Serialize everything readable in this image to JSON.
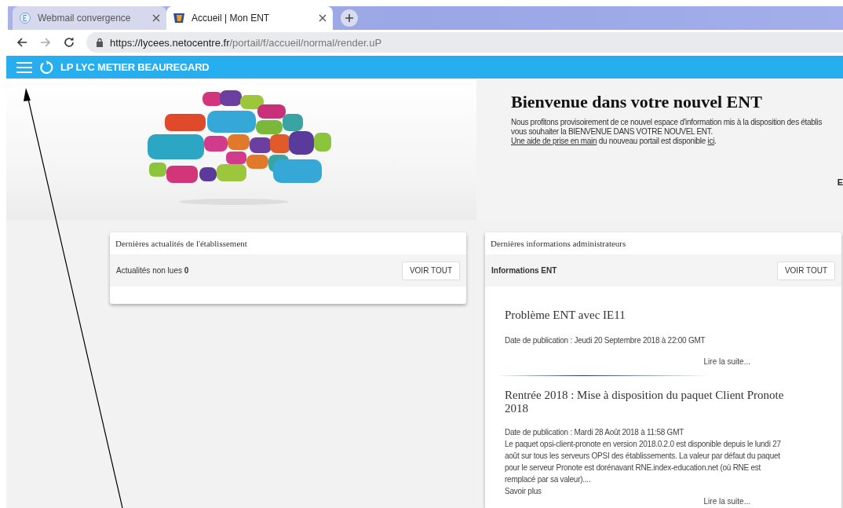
{
  "browser": {
    "tabs": [
      {
        "title": "Webmail convergence",
        "selected": false
      },
      {
        "title": "Accueil | Mon ENT",
        "selected": true
      }
    ],
    "url": {
      "host": "https://lycees.netocentre.fr",
      "path": "/portail/f/accueil/normal/render.uP"
    }
  },
  "app_bar": {
    "title": "LP LYC METIER BEAUREGARD"
  },
  "welcome": {
    "heading": "Bienvenue dans votre nouvel ENT",
    "lines": [
      "Nous profitons provisoirement de ce nouvel espace d'information mis à la disposition des établis",
      "vous souhaiter la BIENVENUE DANS VOTRE NOUVEL ENT."
    ],
    "help_text": [
      {
        "kind": "link",
        "text": "Une aide de prise en main"
      },
      {
        "kind": "text",
        "text": " du nouveau portail est disponible "
      },
      {
        "kind": "link",
        "text": "ici"
      },
      {
        "kind": "text",
        "text": "."
      }
    ],
    "edge_label": "E"
  },
  "news_card": {
    "title": "Dernières actualités de l'établissement",
    "unread_label": "Actualités non lues",
    "unread_count": "0",
    "button": "VOIR TOUT"
  },
  "admin_card": {
    "title": "Dernières informations administrateurs",
    "subtitle": "Informations ENT",
    "button": "VOIR TOUT",
    "articles": [
      {
        "title": "Problème ENT avec IE11",
        "date": "Date de publication : Jeudi 20 Septembre 2018 à 22:00 GMT",
        "read_more": "Lire la suite..."
      },
      {
        "title": "Rentrée 2018 : Mise à disposition du paquet Client Pronote 2018",
        "date": "Date de publication : Mardi 28 Août 2018 à 11:58 GMT",
        "body": "Le paquet opsi-client-pronote en version 2018.0.2.0 est disponible depuis le lundi 27 août sur tous les serveurs OPSI des établissements. La valeur par défaut du paquet pour le serveur Pronote est dorénavant RNE.index-education.net (où RNE est remplacé par sa valeur)....",
        "more": "Savoir plus",
        "read_more": "Lire la suite..."
      }
    ]
  }
}
